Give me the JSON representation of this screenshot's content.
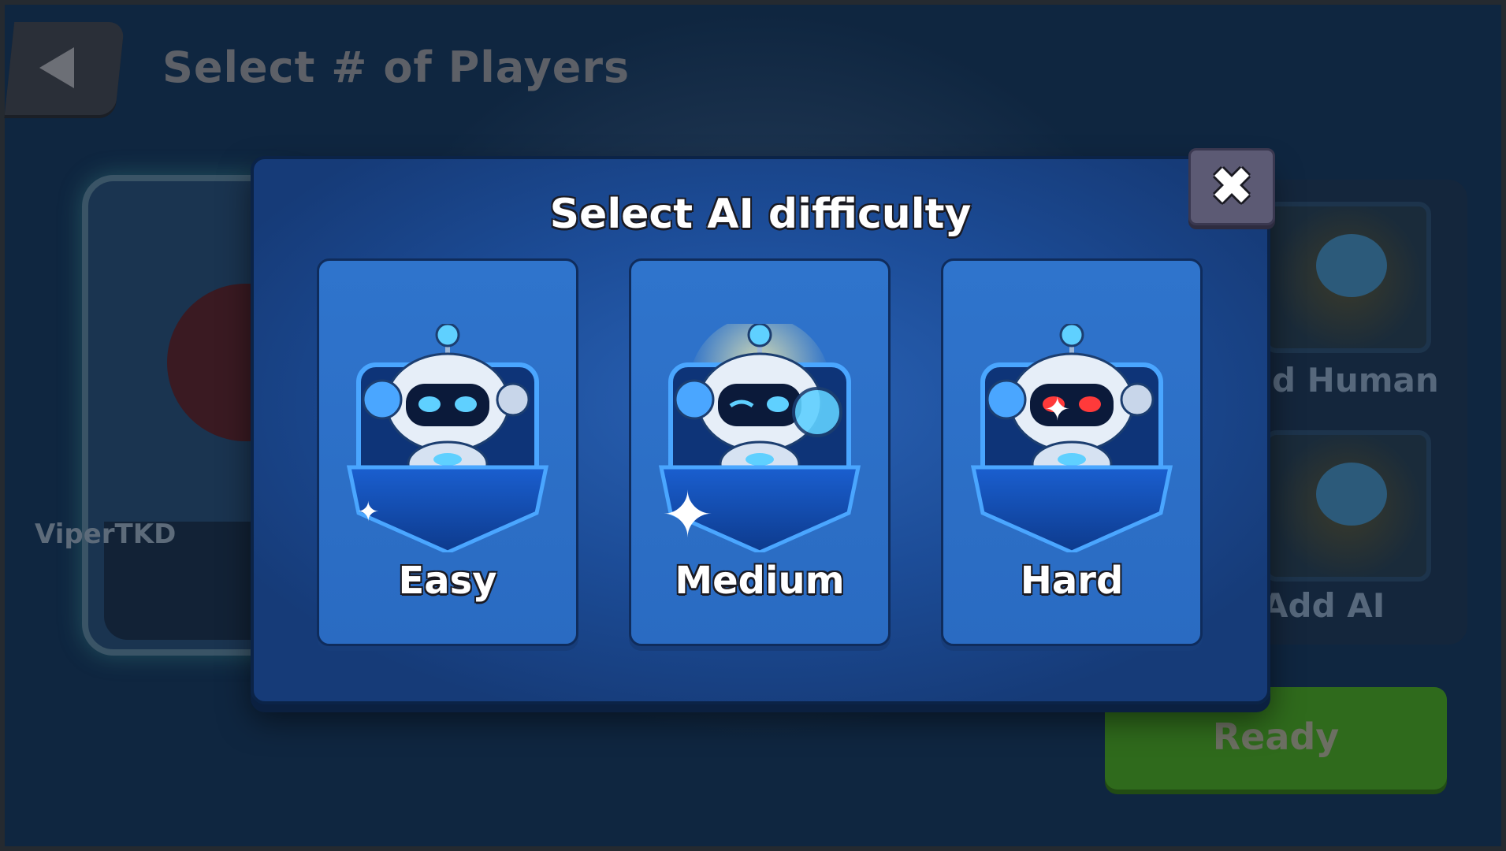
{
  "background": {
    "title": "Select # of Players",
    "player_name": "ViperTKD",
    "add_human_label": "d Human",
    "add_ai_label": "Add AI",
    "ready_label": "Ready"
  },
  "modal": {
    "title": "Select AI difficulty",
    "close_icon": "close-icon",
    "options": [
      {
        "label": "Easy",
        "eye_color": "#5fd0ff"
      },
      {
        "label": "Medium",
        "eye_color": "#5fd0ff"
      },
      {
        "label": "Hard",
        "eye_color": "#ff3a3a"
      }
    ]
  },
  "colors": {
    "modal_bg": "#1c4c97",
    "card_bg": "#2f74cc",
    "ready_green": "#2f6a1c",
    "close_button": "#5c5a74"
  }
}
